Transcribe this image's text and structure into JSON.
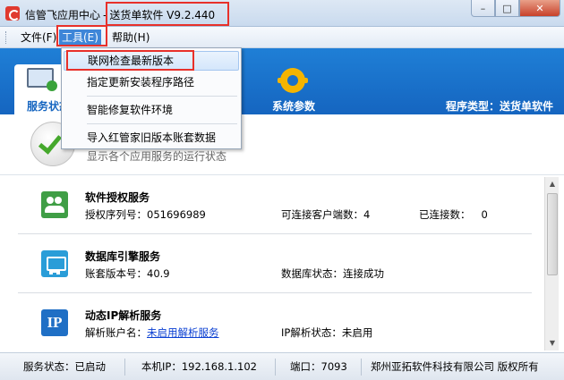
{
  "window": {
    "app_name": "信管飞应用中心",
    "separator": "-",
    "product": "送货单软件 V9.2.440",
    "controls": {
      "minimize": "–",
      "maximize": "□",
      "close": "✕"
    }
  },
  "menubar": {
    "items": [
      {
        "label": "文件(F)"
      },
      {
        "label": "工具(E)"
      },
      {
        "label": "帮助(H)"
      }
    ]
  },
  "tools_menu": {
    "items": [
      {
        "label": "联网检查最新版本"
      },
      {
        "label": "指定更新安装程序路径"
      },
      {
        "label": "智能修复软件环境"
      },
      {
        "label": "导入红管家旧版本账套数据"
      }
    ]
  },
  "banner": {
    "tabs": [
      {
        "label": "服务状态",
        "icon": "monitor-icon"
      },
      {
        "label": "系统参数",
        "icon": "gear-icon"
      }
    ],
    "program_type_label": "程序类型：",
    "program_type_value": "送货单软件"
  },
  "header": {
    "description": "显示各个应用服务的运行状态"
  },
  "services": [
    {
      "title": "软件授权服务",
      "icon": "users-icon",
      "field1_label": "授权序列号：",
      "field1_value": "051696989",
      "field2_label": "可连接客户端数：",
      "field2_value": "4",
      "field3_label": "已连接数：",
      "field3_value": "0"
    },
    {
      "title": "数据库引擎服务",
      "icon": "database-monitor-icon",
      "field1_label": "账套版本号：",
      "field1_value": "40.9",
      "field2_label": "数据库状态：",
      "field2_value": "连接成功"
    },
    {
      "title": "动态IP解析服务",
      "icon": "ip-icon",
      "icon_text": "IP",
      "field1_label": "解析账户名：",
      "field1_link": "未启用解析服务",
      "field2_label": "IP解析状态：",
      "field2_value": "未启用"
    }
  ],
  "statusbar": {
    "service_status": "服务状态：已启动",
    "local_ip": "本机IP：192.168.1.102",
    "port": "端口：7093",
    "company": "郑州亚拓软件科技有限公司  版权所有"
  },
  "colors": {
    "accent_blue": "#1565c0",
    "highlight_red": "#e8302a",
    "success_green": "#45a82c"
  }
}
